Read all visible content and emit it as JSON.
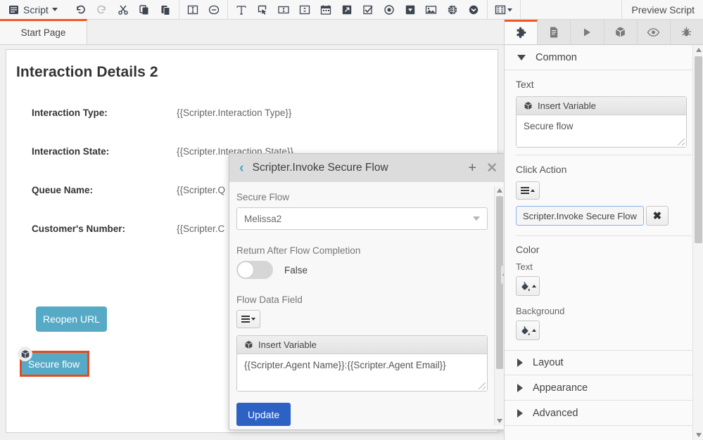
{
  "toolbar": {
    "script_menu_label": "Script",
    "preview_label": "Preview Script",
    "icons": [
      "undo-icon",
      "redo-icon",
      "cut-icon",
      "copy-icon",
      "paste-icon",
      "insert-row-icon",
      "insert-panel-icon",
      "text-icon",
      "button-icon",
      "textbox-icon",
      "spinner-icon",
      "date-picker-icon",
      "link-icon",
      "checkbox-icon",
      "radio-icon",
      "dropdown-icon",
      "image-icon",
      "globe-icon",
      "chevron-circle-icon",
      "grid-icon"
    ]
  },
  "tabs": [
    {
      "label": "Start Page",
      "active": true
    }
  ],
  "canvas": {
    "title": "Interaction Details 2",
    "fields": [
      {
        "label": "Interaction Type:",
        "value": "{{Scripter.Interaction Type}}"
      },
      {
        "label": "Interaction State:",
        "value": "{{Scripter.Interaction State}}"
      },
      {
        "label": "Queue Name:",
        "value": "{{Scripter.Q"
      },
      {
        "label": "Customer's Number:",
        "value": "{{Scripter.C"
      }
    ],
    "reopen_button": "Reopen URL",
    "secure_flow_button": "Secure flow",
    "selection_color": "#e8491d",
    "button_color": "#57aac6"
  },
  "modal": {
    "title": "Scripter.Invoke Secure Flow",
    "back_icon": "chevron-left-icon",
    "add_icon": "plus-icon",
    "close_icon": "close-icon",
    "secure_flow_label": "Secure Flow",
    "secure_flow_value": "Melissa2",
    "return_label": "Return After Flow Completion",
    "return_value": "False",
    "flow_data_field_label": "Flow Data Field",
    "insert_variable_label": "Insert Variable",
    "flow_data_value": "{{Scripter.Agent Name}}:{{Scripter.Agent Email}}",
    "update_button": "Update"
  },
  "right_panel": {
    "tabs": [
      {
        "name": "components-tab",
        "icon": "puzzle-icon",
        "active": true
      },
      {
        "name": "pages-tab",
        "icon": "document-icon",
        "active": false
      },
      {
        "name": "run-tab",
        "icon": "play-icon",
        "active": false
      },
      {
        "name": "variables-tab",
        "icon": "cube-icon",
        "active": false
      },
      {
        "name": "preview-tab",
        "icon": "eye-icon",
        "active": false
      },
      {
        "name": "debug-tab",
        "icon": "bug-icon",
        "active": false
      }
    ],
    "common_section": "Common",
    "text_label": "Text",
    "insert_variable_label": "Insert Variable",
    "text_value": "Secure flow",
    "click_action_label": "Click Action",
    "click_action_value": "Scripter.Invoke Secure Flow",
    "color_label": "Color",
    "color_text_label": "Text",
    "color_background_label": "Background",
    "sections": [
      {
        "label": "Layout"
      },
      {
        "label": "Appearance"
      },
      {
        "label": "Advanced"
      }
    ]
  }
}
